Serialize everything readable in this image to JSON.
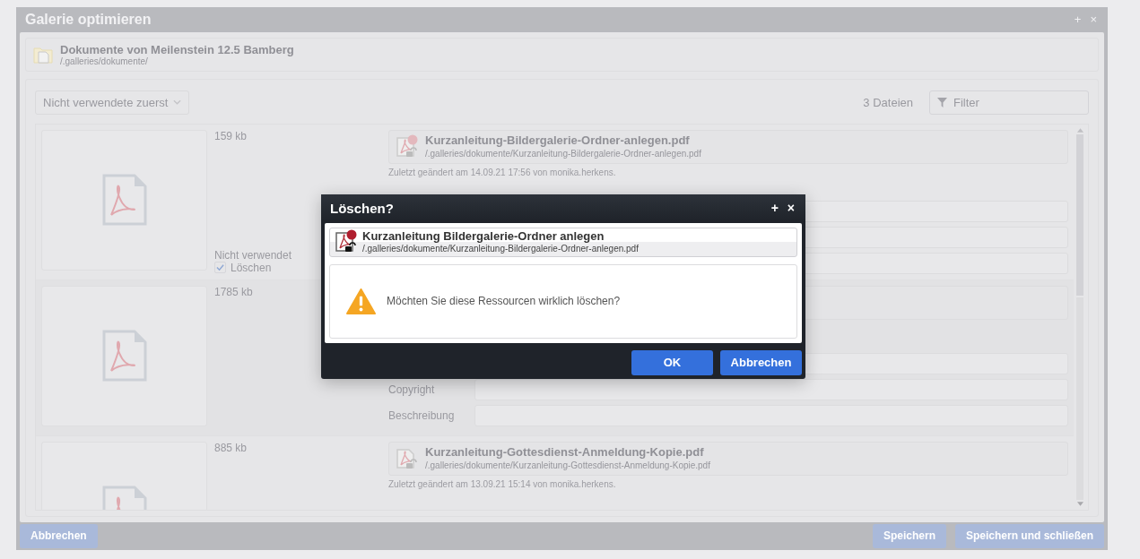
{
  "window": {
    "title": "Galerie optimieren",
    "controls": [
      "+",
      "×"
    ]
  },
  "folder": {
    "name": "Dokumente von Meilenstein 12.5 Bamberg",
    "path": "/.galleries/dokumente/"
  },
  "sort": {
    "value": "Nicht verwendete zuerst"
  },
  "file_count": "3 Dateien",
  "filter": {
    "placeholder": "Filter"
  },
  "files": [
    {
      "size": "159 kb",
      "unused_label": "Nicht verwendet",
      "delete": {
        "label": "Löschen",
        "checked": true
      },
      "file": {
        "kind": "card",
        "name": "Kurzanleitung-Bildergalerie-Ordner-anlegen.pdf",
        "path": "/.galleries/dokumente/Kurzanleitung-Bildergalerie-Ordner-anlegen.pdf",
        "marked": true,
        "modified": "Zuletzt geändert am 14.09.21 17:56 von monika.herkens."
      },
      "fields": [
        {
          "kind": "unlabeled"
        },
        {
          "kind": "unlabeled"
        },
        {
          "kind": "unlabeled"
        }
      ]
    },
    {
      "size": "1785 kb",
      "file": {
        "kind": "covered"
      },
      "fields": [
        {
          "kind": "unlabeled"
        },
        {
          "kind": "labeled",
          "label": "Copyright"
        },
        {
          "kind": "labeled",
          "label": "Beschreibung"
        }
      ]
    },
    {
      "size": "885 kb",
      "file": {
        "kind": "card",
        "name": "Kurzanleitung-Gottesdienst-Anmeldung-Kopie.pdf",
        "path": "/.galleries/dokumente/Kurzanleitung-Gottesdienst-Anmeldung-Kopie.pdf",
        "marked": false,
        "modified": "Zuletzt geändert am 13.09.21 15:14 von monika.herkens."
      }
    }
  ],
  "footer": {
    "left_buttons": [
      "Abbrechen"
    ],
    "right_buttons": [
      "Speichern",
      "Speichern und schließen"
    ]
  },
  "dialog": {
    "title": "Löschen?",
    "controls": [
      "+",
      "×"
    ],
    "resource": {
      "title": "Kurzanleitung Bildergalerie-Ordner anlegen",
      "path": "/.galleries/dokumente/Kurzanleitung-Bildergalerie-Ordner-anlegen.pdf",
      "marked": true
    },
    "message": "Möchten Sie diese Ressourcen wirklich löschen?",
    "buttons": [
      "OK",
      "Abbrechen"
    ]
  }
}
